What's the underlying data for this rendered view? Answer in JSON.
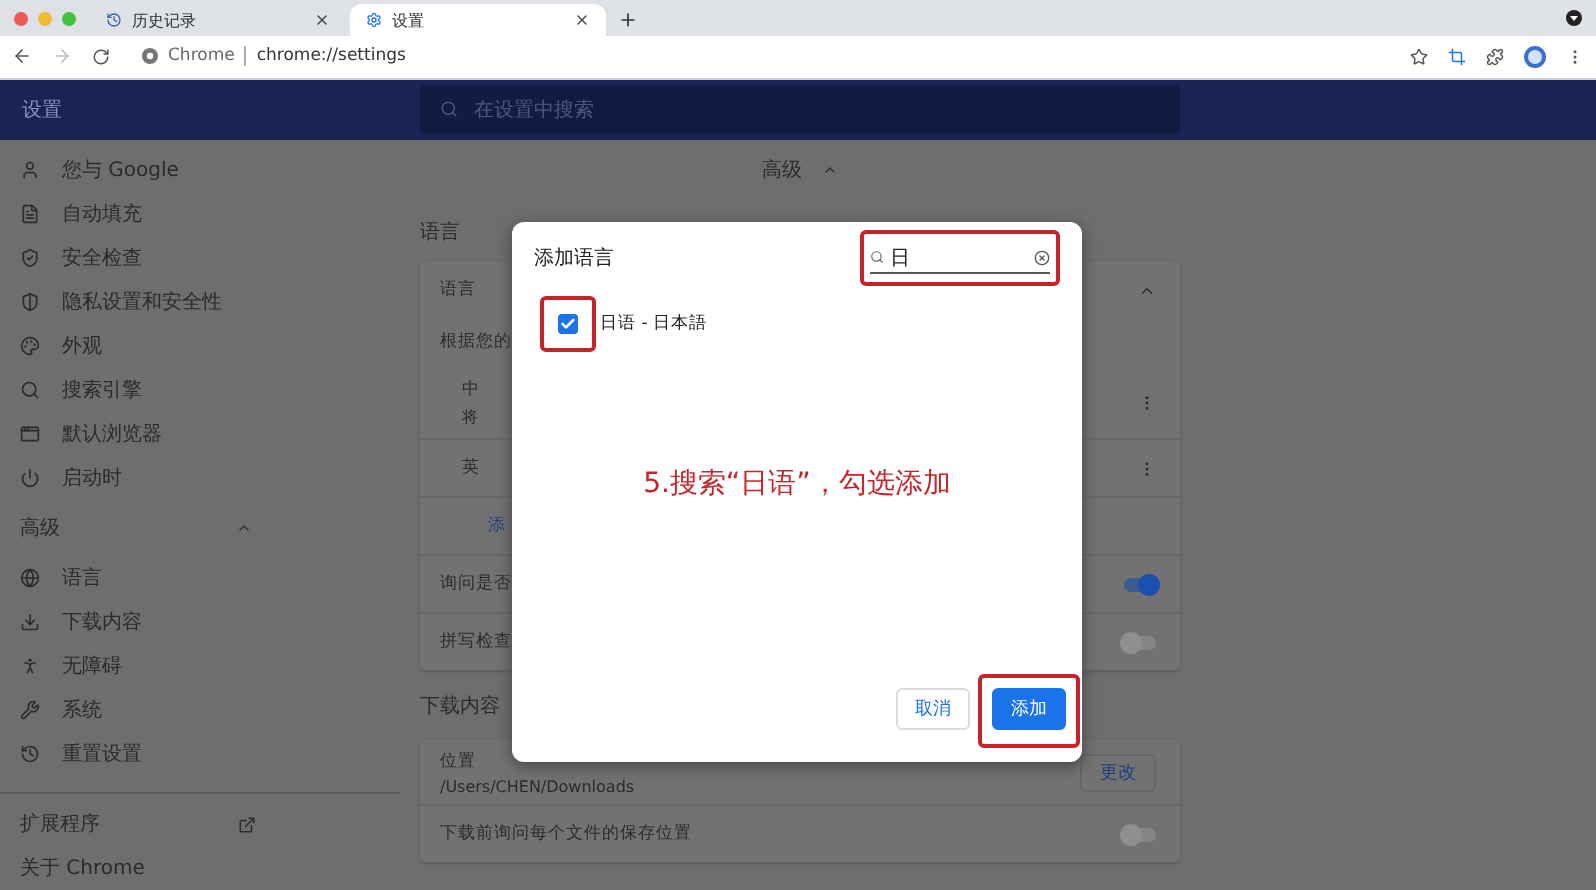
{
  "browser": {
    "tabs": [
      {
        "title": "历史记录",
        "selected": false
      },
      {
        "title": "设置",
        "selected": true
      }
    ],
    "address": {
      "site": "Chrome",
      "url": "chrome://settings"
    }
  },
  "header": {
    "title": "设置",
    "search": {
      "placeholder": "在设置中搜索"
    }
  },
  "sidebar": {
    "items": [
      {
        "label": "您与 Google"
      },
      {
        "label": "自动填充"
      },
      {
        "label": "安全检查"
      },
      {
        "label": "隐私设置和安全性"
      },
      {
        "label": "外观"
      },
      {
        "label": "搜索引擎"
      },
      {
        "label": "默认浏览器"
      },
      {
        "label": "启动时"
      }
    ],
    "advanced": {
      "label": "高级",
      "expanded": true
    },
    "advanced_items": [
      {
        "label": "语言"
      },
      {
        "label": "下载内容"
      },
      {
        "label": "无障碍"
      },
      {
        "label": "系统"
      },
      {
        "label": "重置设置"
      }
    ],
    "extensions": "扩展程序",
    "about": "关于 Chrome"
  },
  "main": {
    "advanced": {
      "label": "高级",
      "expanded": true
    },
    "language": {
      "heading": "语言",
      "card_title": "语言",
      "description": "根据您的",
      "languages": [
        {
          "name": "中",
          "detail": "将"
        },
        {
          "name": "英"
        }
      ],
      "add_link": "添",
      "rows": [
        {
          "label": "询问是否",
          "on": true
        },
        {
          "label": "拼写检查",
          "on": false
        }
      ]
    },
    "downloads": {
      "heading": "下载内容",
      "location_label": "位置",
      "location_path": "/Users/CHEN/Downloads",
      "change_button": "更改",
      "ask": {
        "label": "下载前询问每个文件的保存位置",
        "on": false
      }
    }
  },
  "dialog": {
    "title": "添加语言",
    "search_value": "日",
    "options": [
      {
        "label": "日语 - 日本語",
        "checked": true
      }
    ],
    "buttons": [
      {
        "label": "取消",
        "kind": "secondary"
      },
      {
        "label": "添加",
        "kind": "primary"
      }
    ]
  },
  "annotation": {
    "text": "5.搜索“日语”，勾选添加"
  }
}
